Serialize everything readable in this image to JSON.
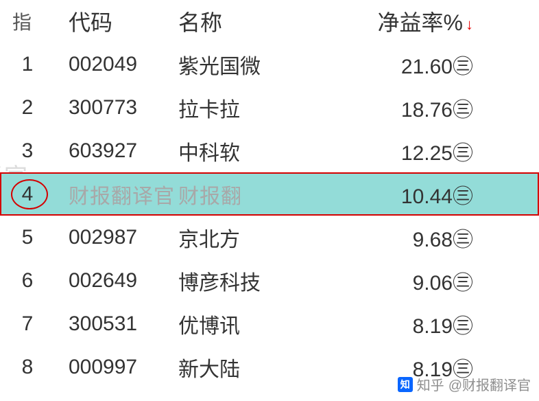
{
  "chart_data": {
    "type": "table",
    "title": "",
    "columns": [
      "代码",
      "名称",
      "净益率%"
    ],
    "rows": [
      {
        "rank": 1,
        "code": "002049",
        "name": "紫光国微",
        "net_margin": 21.6
      },
      {
        "rank": 2,
        "code": "300773",
        "name": "拉卡拉",
        "net_margin": 18.76
      },
      {
        "rank": 3,
        "code": "603927",
        "name": "中科软",
        "net_margin": 12.25
      },
      {
        "rank": 4,
        "code": "财报翻译官",
        "name": "财报翻译官",
        "net_margin": 10.44,
        "highlighted": true
      },
      {
        "rank": 5,
        "code": "002987",
        "name": "京北方",
        "net_margin": 9.68
      },
      {
        "rank": 6,
        "code": "002649",
        "name": "博彦科技",
        "net_margin": 9.06
      },
      {
        "rank": 7,
        "code": "300531",
        "name": "优博讯",
        "net_margin": 8.19
      },
      {
        "rank": 8,
        "code": "000997",
        "name": "新大陆",
        "net_margin": 8.19
      }
    ],
    "sort_column": "净益率%",
    "sort_direction": "desc"
  },
  "header": {
    "zhi": "指",
    "code": "代码",
    "name": "名称",
    "rate": "净益率%"
  },
  "rows": {
    "r1": {
      "idx": "1",
      "code": "002049",
      "name": "紫光国微",
      "rate": "21.60㊂"
    },
    "r2": {
      "idx": "2",
      "code": "300773",
      "name": "拉卡拉",
      "rate": "18.76㊂"
    },
    "r3": {
      "idx": "3",
      "code": "603927",
      "name": "中科软",
      "rate": "12.25㊂"
    },
    "r4": {
      "idx": "4",
      "code": "财报翻译官",
      "name": "财报翻",
      "rate": "10.44㊂"
    },
    "r5": {
      "idx": "5",
      "code": "002987",
      "name": "京北方",
      "rate": "9.68㊂"
    },
    "r6": {
      "idx": "6",
      "code": "002649",
      "name": "博彦科技",
      "rate": "9.06㊂"
    },
    "r7": {
      "idx": "7",
      "code": "300531",
      "name": "优博讯",
      "rate": "8.19㊂"
    },
    "r8": {
      "idx": "8",
      "code": "000997",
      "name": "新大陆",
      "rate": "8.19㊂"
    }
  },
  "watermark": "译官",
  "source": {
    "platform": "知乎",
    "author": "@财报翻译官"
  }
}
